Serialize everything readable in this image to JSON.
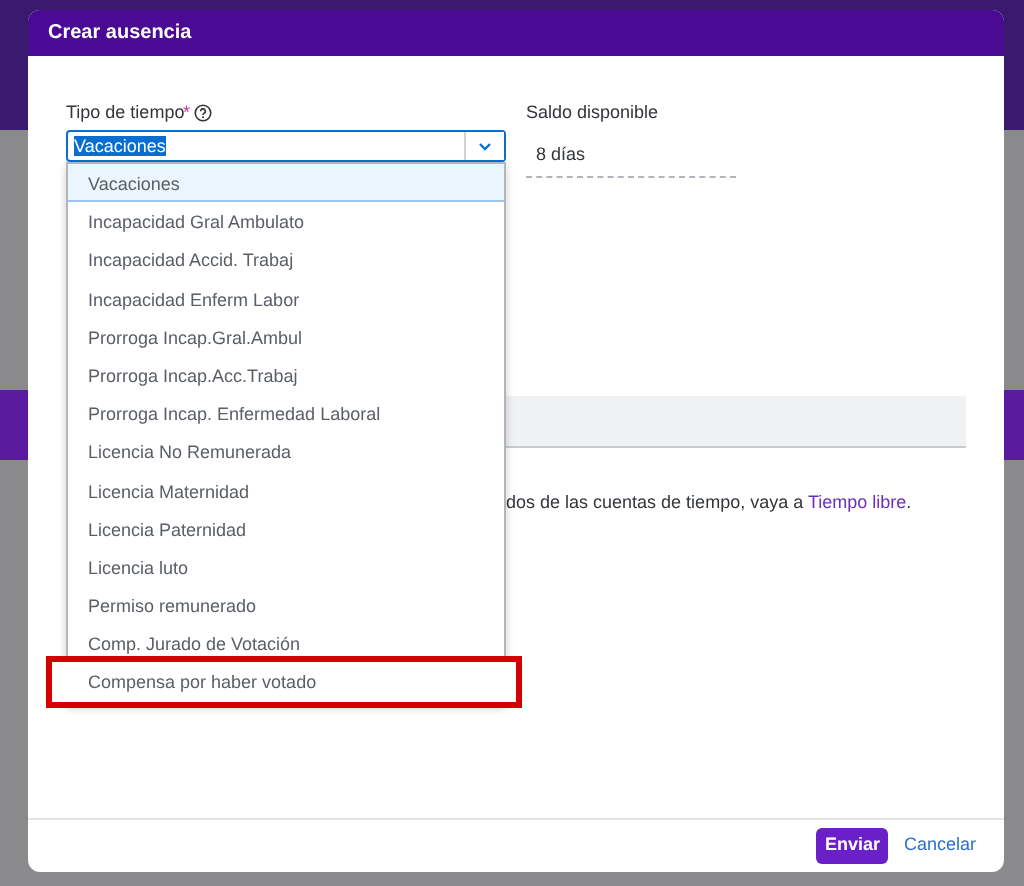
{
  "dialog": {
    "title": "Crear ausencia"
  },
  "time_type": {
    "label": "Tipo de tiempo",
    "required_mark": "*",
    "value": "Vacaciones",
    "text_selected": true,
    "expanded": true,
    "options": [
      {
        "label": "Vacaciones",
        "selected": true,
        "highlighted": false
      },
      {
        "label": "Incapacidad Gral Ambulato",
        "selected": false,
        "highlighted": false
      },
      {
        "label": "Incapacidad Accid. Trabaj",
        "selected": false,
        "highlighted": false
      },
      {
        "label": "Incapacidad Enferm Labor",
        "selected": false,
        "highlighted": false
      },
      {
        "label": "Prorroga Incap.Gral.Ambul",
        "selected": false,
        "highlighted": false
      },
      {
        "label": "Prorroga Incap.Acc.Trabaj",
        "selected": false,
        "highlighted": false
      },
      {
        "label": "Prorroga Incap. Enfermedad Laboral",
        "selected": false,
        "highlighted": false
      },
      {
        "label": "Licencia No Remunerada",
        "selected": false,
        "highlighted": false
      },
      {
        "label": "Licencia Maternidad",
        "selected": false,
        "highlighted": false
      },
      {
        "label": "Licencia Paternidad",
        "selected": false,
        "highlighted": false
      },
      {
        "label": "Licencia luto",
        "selected": false,
        "highlighted": false
      },
      {
        "label": "Permiso remunerado",
        "selected": false,
        "highlighted": false
      },
      {
        "label": "Comp. Jurado de Votación",
        "selected": false,
        "highlighted": false
      },
      {
        "label": "Compensa por haber votado",
        "selected": false,
        "highlighted": true
      }
    ]
  },
  "balance": {
    "label": "Saldo disponible",
    "value": "8 días"
  },
  "info": {
    "text": "dos de las cuentas de tiempo, vaya a",
    "link": "Tiempo libre",
    "end": "."
  },
  "buttons": [
    {
      "label": "Enviar",
      "kind": "primary"
    },
    {
      "label": "Cancelar",
      "kind": "link"
    }
  ]
}
